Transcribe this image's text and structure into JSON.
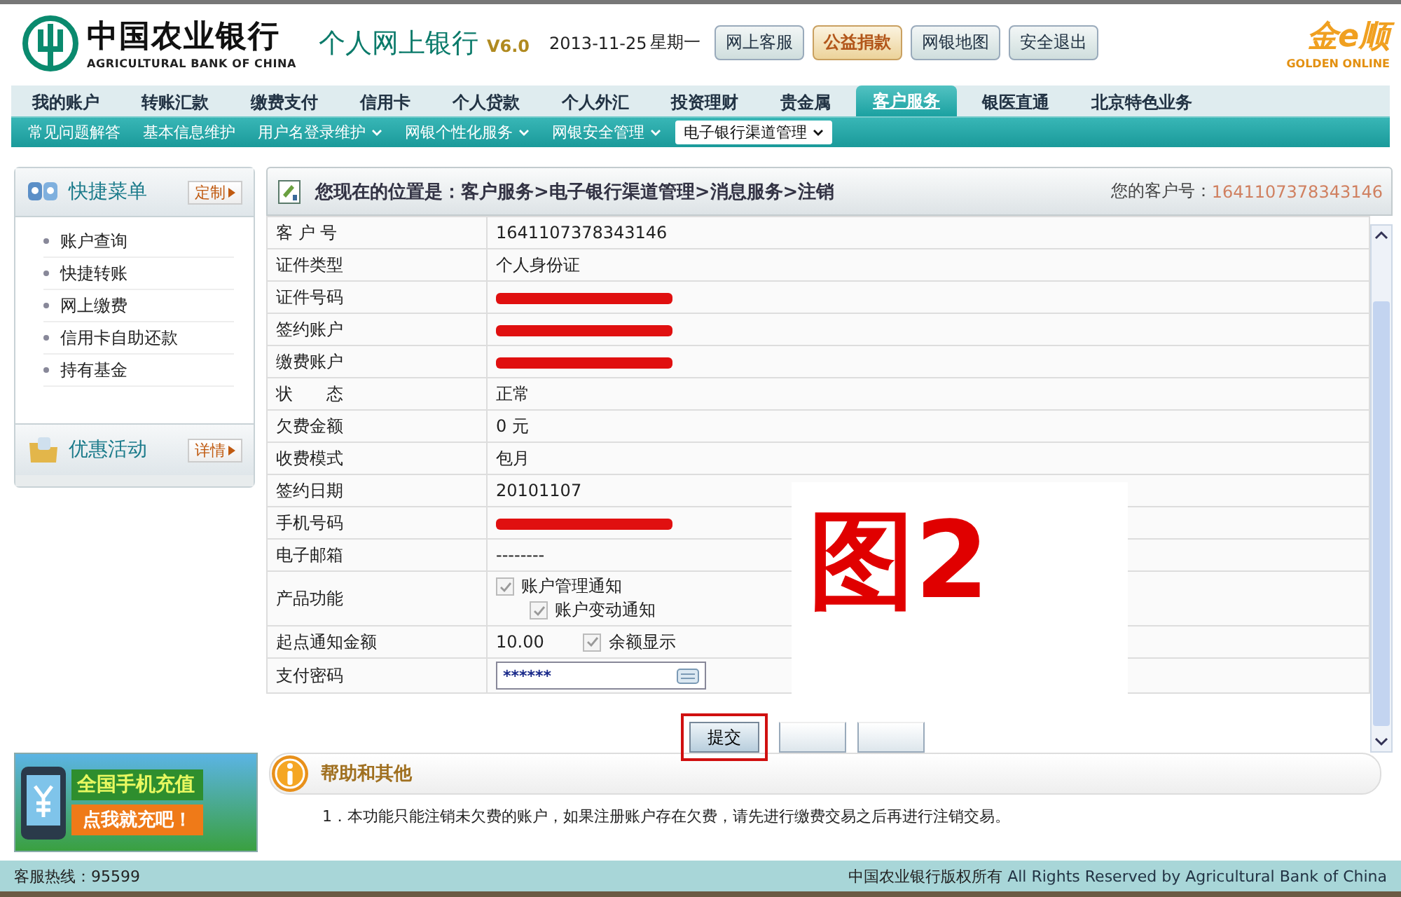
{
  "header": {
    "bank_name_cn": "中国农业银行",
    "bank_name_en": "AGRICULTURAL BANK OF CHINA",
    "product": "个人网上银行",
    "version": "V6.0",
    "date": "2013-11-25",
    "weekday": "星期一",
    "buttons": [
      {
        "label": "网上客服",
        "kind": "normal"
      },
      {
        "label": "公益捐款",
        "kind": "highlight"
      },
      {
        "label": "网银地图",
        "kind": "normal"
      },
      {
        "label": "安全退出",
        "kind": "normal"
      }
    ],
    "brand_cn": "金e顺",
    "brand_en": "GOLDEN ONLINE"
  },
  "main_nav": [
    {
      "label": "我的账户",
      "selected": false
    },
    {
      "label": "转账汇款",
      "selected": false
    },
    {
      "label": "缴费支付",
      "selected": false
    },
    {
      "label": "信用卡",
      "selected": false
    },
    {
      "label": "个人贷款",
      "selected": false
    },
    {
      "label": "个人外汇",
      "selected": false
    },
    {
      "label": "投资理财",
      "selected": false
    },
    {
      "label": "贵金属",
      "selected": false
    },
    {
      "label": "客户服务",
      "selected": true
    },
    {
      "label": "银医直通",
      "selected": false
    },
    {
      "label": "北京特色业务",
      "selected": false
    }
  ],
  "sub_nav": [
    {
      "label": "常见问题解答",
      "dropdown": false,
      "selected": false
    },
    {
      "label": "基本信息维护",
      "dropdown": false,
      "selected": false
    },
    {
      "label": "用户名登录维护",
      "dropdown": true,
      "selected": false
    },
    {
      "label": "网银个性化服务",
      "dropdown": true,
      "selected": false
    },
    {
      "label": "网银安全管理",
      "dropdown": true,
      "selected": false
    },
    {
      "label": "电子银行渠道管理",
      "dropdown": true,
      "selected": true
    }
  ],
  "sidebar": {
    "quick_menu": {
      "title": "快捷菜单",
      "button": "定制",
      "items": [
        "账户查询",
        "快捷转账",
        "网上缴费",
        "信用卡自助还款",
        "持有基金"
      ]
    },
    "promotions": {
      "title": "优惠活动",
      "button": "详情"
    },
    "banner": {
      "line1": "全国手机充值",
      "line2": "点我就充吧！"
    }
  },
  "breadcrumb": {
    "prefix": "您现在的位置是：",
    "path": "客户服务>电子银行渠道管理>消息服务>注销",
    "customer_label": "您的客户号：",
    "customer_number": "1641107378343146"
  },
  "form": [
    {
      "label": "客 户 号",
      "kind": "text",
      "value": "1641107378343146"
    },
    {
      "label": "证件类型",
      "kind": "text",
      "value": "个人身份证"
    },
    {
      "label": "证件号码",
      "kind": "redacted"
    },
    {
      "label": "签约账户",
      "kind": "redacted"
    },
    {
      "label": "缴费账户",
      "kind": "redacted"
    },
    {
      "label": "状　　态",
      "kind": "text",
      "value": "正常"
    },
    {
      "label": "欠费金额",
      "kind": "text",
      "value": "0 元"
    },
    {
      "label": "收费模式",
      "kind": "text",
      "value": "包月"
    },
    {
      "label": "签约日期",
      "kind": "text",
      "value": "20101107"
    },
    {
      "label": "手机号码",
      "kind": "redacted"
    },
    {
      "label": "电子邮箱",
      "kind": "text",
      "value": "--------"
    },
    {
      "label": "产品功能",
      "kind": "checks",
      "checks": [
        {
          "label": "账户管理通知",
          "checked": true
        },
        {
          "label": "账户变动通知",
          "checked": true
        }
      ]
    },
    {
      "label": "起点通知金额",
      "kind": "amount",
      "value": "10.00",
      "checks": [
        {
          "label": "余额显示",
          "checked": true
        }
      ]
    },
    {
      "label": "支付密码",
      "kind": "password",
      "value": "******"
    }
  ],
  "actions": {
    "submit": "提交",
    "submit_highlighted": true
  },
  "annotation": "图2",
  "help": {
    "title": "帮助和其他",
    "items": [
      "1．本功能只能注销未欠费的账户，如果注册账户存在欠费，请先进行缴费交易之后再进行注销交易。"
    ]
  },
  "footer": {
    "hotline": "客服热线：95599",
    "copyright_cn": "中国农业银行版权所有",
    "copyright_en": "All Rights Reserved by Agricultural Bank of China"
  }
}
